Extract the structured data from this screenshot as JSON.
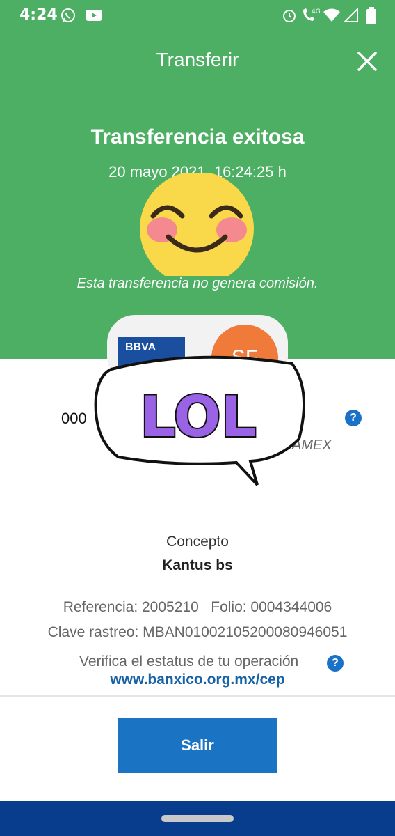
{
  "status_bar": {
    "time": "4:24",
    "network": "4G"
  },
  "header": {
    "title": "Transferir"
  },
  "result": {
    "title": "Transferencia exitosa",
    "datetime": "20 mayo 2021, 16:24:25 h",
    "fee_note": "Esta transferencia no genera comisión."
  },
  "banks": {
    "origin": "BBVA",
    "destination": "SF"
  },
  "account": {
    "number_visible": "000",
    "bank_suffix": "AMEX"
  },
  "details": {
    "concept_label": "Concepto",
    "concept_value": "Kantus bs",
    "reference_line": "Referencia: 2005210   Folio: 0004344006",
    "tracking_line": "Clave rastreo: MBAN01002105200080946051",
    "verify_text": "Verifica el estatus de tu operación",
    "verify_link": "www.banxico.org.mx/cep"
  },
  "actions": {
    "exit_label": "Salir"
  },
  "stickers": {
    "overlay_text": "LOL"
  },
  "colors": {
    "header_green": "#4caf63",
    "button_blue": "#1a73c3",
    "link_blue": "#1762a7",
    "nav_blue": "#083c8c"
  }
}
